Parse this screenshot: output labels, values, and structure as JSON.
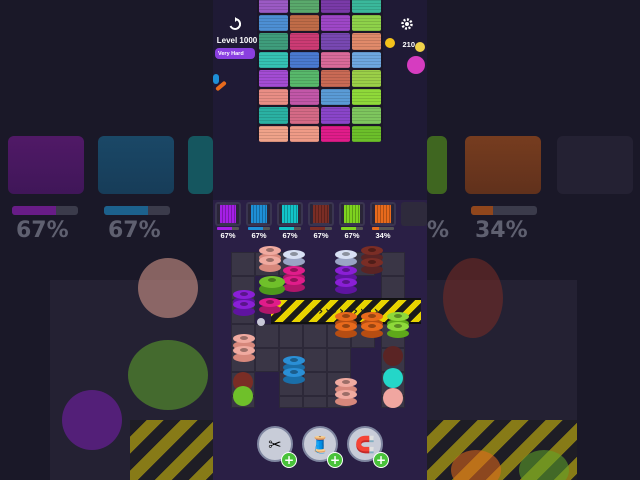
{
  "level": {
    "title": "Level 1000",
    "difficulty": "Very Hard"
  },
  "coins": {
    "value": "210"
  },
  "icons": {
    "restart": "restart-icon",
    "settings": "gear-icon",
    "coin": "coin-icon"
  },
  "spools": [
    {
      "color": "#a51fe6",
      "percent": "67%",
      "progress": 0.67
    },
    {
      "color": "#1e8fd6",
      "percent": "67%",
      "progress": 0.67
    },
    {
      "color": "#12c4c9",
      "percent": "67%",
      "progress": 0.67
    },
    {
      "color": "#7a2d25",
      "percent": "67%",
      "progress": 0.67
    },
    {
      "color": "#7ed31f",
      "percent": "67%",
      "progress": 0.67
    },
    {
      "color": "#e86a1c",
      "percent": "34%",
      "progress": 0.34
    }
  ],
  "side_left": {
    "pct1": "67%",
    "pct2": "67%"
  },
  "side_right": {
    "pct1": "%",
    "pct2": "34%"
  },
  "fabric_colors": [
    "#9b5ac4",
    "#5aa96c",
    "#7a3aa8",
    "#3ab89b",
    "#4d8fd4",
    "#c06c48",
    "#9e47c7",
    "#8ed24a",
    "#3f9d7c",
    "#cc3b74",
    "#7848b2",
    "#e08a6a",
    "#35c2b4",
    "#4a7ad0",
    "#d96a99",
    "#6ea7e0",
    "#a34cd3",
    "#58b86b",
    "#c96a55",
    "#9bcf48",
    "#e98e85",
    "#c257a8",
    "#5a9bd6",
    "#8fd93a",
    "#2ab1a3",
    "#d56a86",
    "#8a45c9",
    "#7ec65e",
    "#f0a38a",
    "#ef9b87",
    "#e01c8a",
    "#6cbf2a"
  ],
  "boosters": [
    {
      "name": "scissors-booster",
      "icon": "✂"
    },
    {
      "name": "thread-booster",
      "icon": "🧵"
    },
    {
      "name": "magnet-booster",
      "icon": "🧲"
    }
  ],
  "booster_plus": "+"
}
